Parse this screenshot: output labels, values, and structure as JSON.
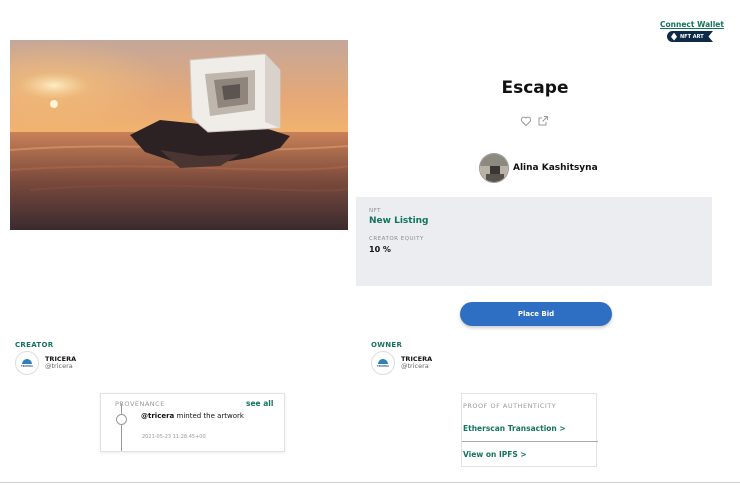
{
  "header": {
    "connect_wallet": "Connect Wallet",
    "badge_text": "NFT ART"
  },
  "artwork": {
    "alt": "Escape artwork: cube structure on a rocky island at sunset"
  },
  "title": "Escape",
  "icons": {
    "like": "heart-icon",
    "share": "share-icon"
  },
  "artist": {
    "name": "Alina Kashitsyna"
  },
  "info": {
    "nft_label": "NFT",
    "nft_value": "New Listing",
    "equity_label": "CREATOR EQUITY",
    "equity_value": "10 %"
  },
  "bid_button": "Place Bid",
  "creator": {
    "label": "CREATOR",
    "name": "TRICERA",
    "handle": "@tricera",
    "logo_text": "TRICERA"
  },
  "owner": {
    "label": "OWNER",
    "name": "TRICERA",
    "handle": "@tricera",
    "logo_text": "TRICERA"
  },
  "provenance": {
    "header": "PROVENANCE",
    "see_all": "see all",
    "event_user": "@tricera",
    "event_text": " minted the artwork",
    "timestamp": "2021-05-23 11:28:45+00"
  },
  "proof": {
    "header": "PROOF OF AUTHENTICITY",
    "etherscan": "Etherscan Transaction >",
    "ipfs": "View on IPFS >"
  },
  "colors": {
    "accent": "#14735f",
    "button": "#2f6fc3",
    "panel": "#ebedf0"
  }
}
